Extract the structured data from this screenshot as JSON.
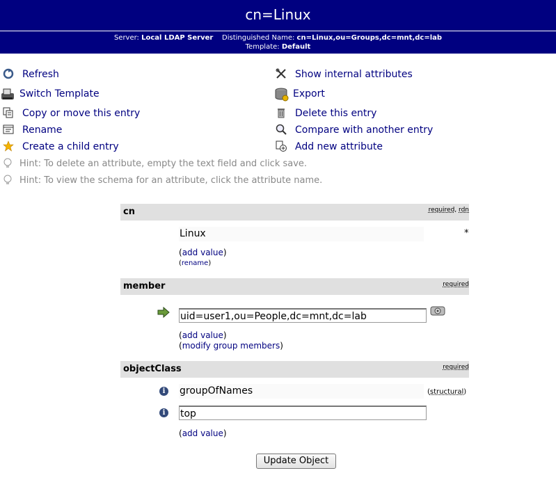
{
  "header": {
    "title": "cn=Linux",
    "server_label": "Server:",
    "server_value": "Local LDAP Server",
    "dn_label": "Distinguished Name:",
    "dn_value": "cn=Linux,ou=Groups,dc=mnt,dc=lab",
    "template_label": "Template:",
    "template_value": "Default"
  },
  "actions": {
    "refresh": "Refresh",
    "switch_template": "Switch Template",
    "copy_move": "Copy or move this entry",
    "rename": "Rename",
    "create_child": "Create a child entry",
    "show_internal": "Show internal attributes",
    "export": "Export",
    "delete": "Delete this entry",
    "compare": "Compare with another entry",
    "add_attribute": "Add new attribute"
  },
  "hints": [
    "Hint: To delete an attribute, empty the text field and click save.",
    "Hint: To view the schema for an attribute, click the attribute name."
  ],
  "attributes": {
    "cn": {
      "name": "cn",
      "tag_required": "required",
      "tag_sep": ", ",
      "tag_rdn": "rdn",
      "value": "Linux",
      "asterisk": "*",
      "add_value": "add value",
      "rename": "rename"
    },
    "member": {
      "name": "member",
      "tag_required": "required",
      "value": "uid=user1,ou=People,dc=mnt,dc=lab",
      "add_value": "add value",
      "modify": "modify group members"
    },
    "objectClass": {
      "name": "objectClass",
      "tag_required": "required",
      "value1": "groupOfNames",
      "structural": "structural",
      "value2": "top",
      "add_value": "add value"
    }
  },
  "paren_open": "(",
  "paren_close": ")",
  "submit_label": "Update Object",
  "colors": {
    "header_bg": "#000080",
    "link": "#000080",
    "section_bg": "#e0e0e0"
  }
}
